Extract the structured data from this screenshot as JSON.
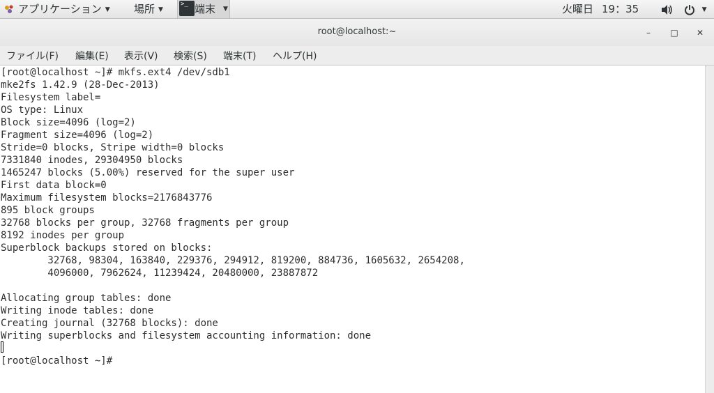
{
  "panel": {
    "applications_label": "アプリケーション",
    "places_label": "場所",
    "terminal_label": "端末",
    "terminal_icon_glyph": ">_",
    "day": "火曜日",
    "time": "19：35"
  },
  "window": {
    "title": "root@localhost:~",
    "minimize_glyph": "–",
    "maximize_glyph": "□",
    "close_glyph": "✕"
  },
  "menu": {
    "items": [
      "ファイル(F)",
      "編集(E)",
      "表示(V)",
      "検索(S)",
      "端末(T)",
      "ヘルプ(H)"
    ]
  },
  "terminal": {
    "lines": [
      "[root@localhost ~]# mkfs.ext4 /dev/sdb1",
      "mke2fs 1.42.9 (28-Dec-2013)",
      "Filesystem label=",
      "OS type: Linux",
      "Block size=4096 (log=2)",
      "Fragment size=4096 (log=2)",
      "Stride=0 blocks, Stripe width=0 blocks",
      "7331840 inodes, 29304950 blocks",
      "1465247 blocks (5.00%) reserved for the super user",
      "First data block=0",
      "Maximum filesystem blocks=2176843776",
      "895 block groups",
      "32768 blocks per group, 32768 fragments per group",
      "8192 inodes per group",
      "Superblock backups stored on blocks:",
      "        32768, 98304, 163840, 229376, 294912, 819200, 884736, 1605632, 2654208,",
      "        4096000, 7962624, 11239424, 20480000, 23887872",
      "",
      "Allocating group tables: done",
      "Writing inode tables: done",
      "Creating journal (32768 blocks): done",
      "Writing superblocks and filesystem accounting information: done",
      "",
      "[root@localhost ~]#"
    ]
  },
  "colors": {
    "terminal_background": "#ffffff",
    "terminal_text": "#2e2e2e",
    "panel_background": "#ececec"
  }
}
